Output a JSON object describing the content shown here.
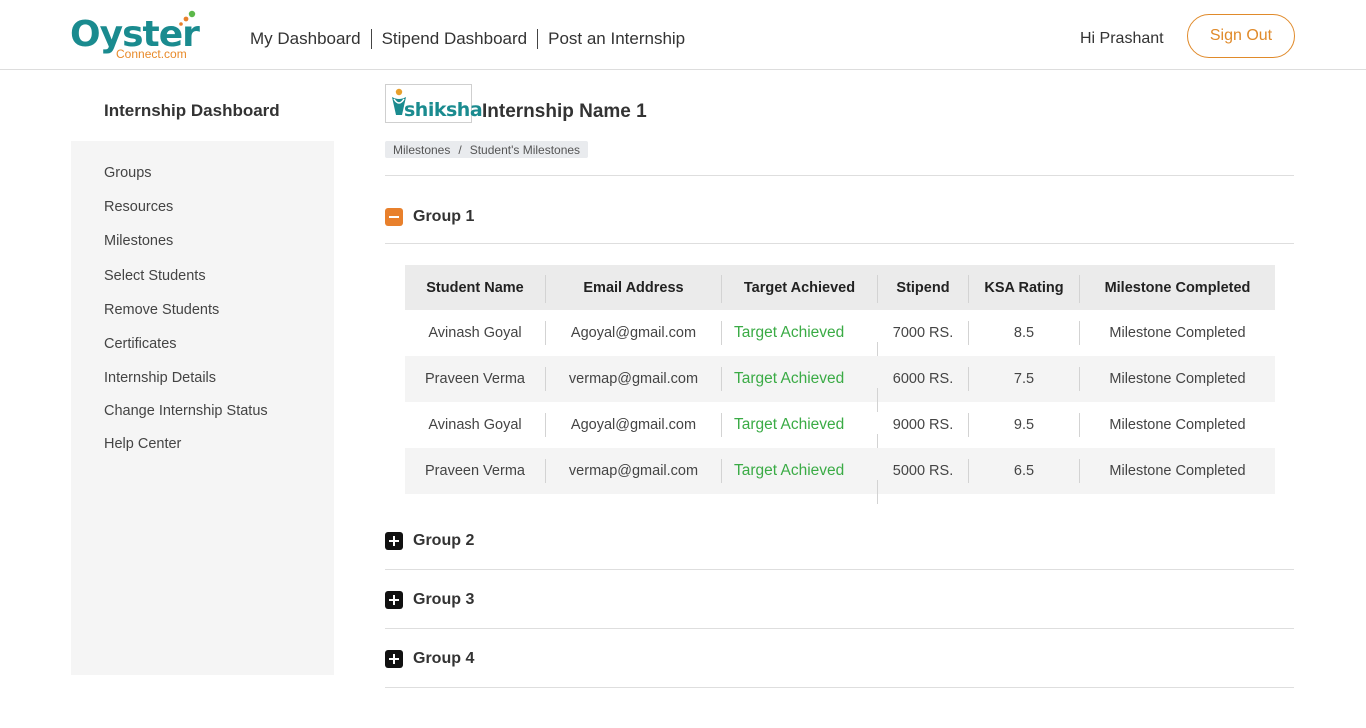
{
  "header": {
    "logo_text": "Oyster",
    "logo_subtext": "Connect.com",
    "nav": [
      "My Dashboard",
      "Stipend Dashboard",
      "Post an Internship"
    ],
    "greeting": "Hi Prashant",
    "signout_label": "Sign Out"
  },
  "sidebar": {
    "title": "Internship Dashboard",
    "items": [
      "Groups",
      "Resources",
      "Milestones",
      "Select Students",
      "Remove Students",
      "Certificates",
      "Internship Details",
      "Change Internship Status",
      "Help Center"
    ]
  },
  "main": {
    "brand_logo_text": "shiksha",
    "title": "Internship Name 1",
    "breadcrumb": [
      "Milestones",
      "Student's Milestones"
    ],
    "groups": [
      {
        "label": "Group 1",
        "expanded": true
      },
      {
        "label": "Group 2",
        "expanded": false
      },
      {
        "label": "Group 3",
        "expanded": false
      },
      {
        "label": "Group 4",
        "expanded": false
      }
    ],
    "table": {
      "columns": [
        "Student Name",
        "Email Address",
        "Target Achieved",
        "Stipend",
        "KSA Rating",
        "Milestone Completed"
      ],
      "rows": [
        [
          "Avinash Goyal",
          "Agoyal@gmail.com",
          "Target Achieved",
          "7000 RS.",
          "8.5",
          "Milestone Completed"
        ],
        [
          "Praveen Verma",
          "vermap@gmail.com",
          "Target Achieved",
          "6000 RS.",
          "7.5",
          "Milestone Completed"
        ],
        [
          "Avinash Goyal",
          "Agoyal@gmail.com",
          "Target Achieved",
          "9000 RS.",
          "9.5",
          "Milestone Completed"
        ],
        [
          "Praveen Verma",
          "vermap@gmail.com",
          "Target Achieved",
          "5000 RS.",
          "6.5",
          "Milestone Completed"
        ]
      ]
    }
  },
  "colors": {
    "brand_teal": "#1a8b8f",
    "accent_orange": "#e8802c",
    "success_green": "#3aab45"
  }
}
